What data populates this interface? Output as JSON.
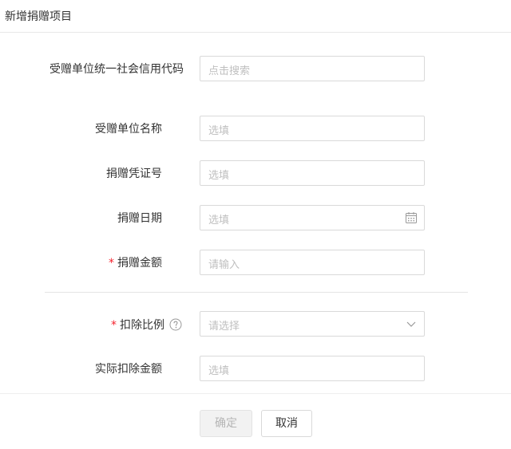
{
  "dialog": {
    "title": "新增捐赠项目"
  },
  "form": {
    "credit_code": {
      "label": "受赠单位统一社会信用代码",
      "placeholder": "点击搜索"
    },
    "recipient_name": {
      "label": "受赠单位名称",
      "placeholder": "选填"
    },
    "voucher_no": {
      "label": "捐赠凭证号",
      "placeholder": "选填"
    },
    "donation_date": {
      "label": "捐赠日期",
      "placeholder": "选填",
      "icon": "calendar-icon"
    },
    "donation_amount": {
      "label": "捐赠金额",
      "placeholder": "请输入",
      "required_mark": "*"
    },
    "deduction_ratio": {
      "label": "扣除比例",
      "placeholder": "请选择",
      "required_mark": "*",
      "help_icon": "question-circle-icon",
      "trailing_icon": "chevron-down-icon"
    },
    "actual_deduction": {
      "label": "实际扣除金额",
      "placeholder": "选填"
    }
  },
  "footer": {
    "confirm_label": "确定",
    "cancel_label": "取消"
  },
  "colors": {
    "required": "#f5222d",
    "border": "#d9d9d9",
    "placeholder": "#bfbfbf",
    "disabled_bg": "#f2f2f2"
  }
}
